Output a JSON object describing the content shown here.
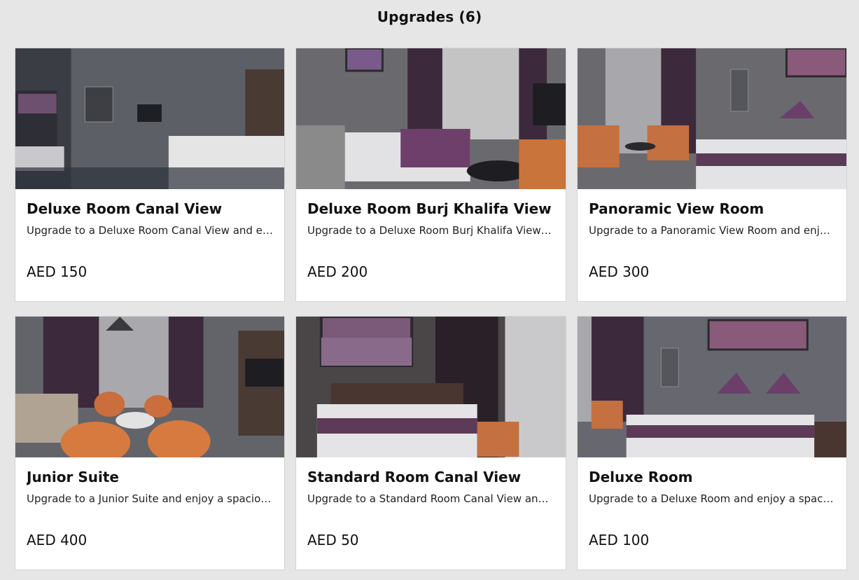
{
  "header": {
    "title": "Upgrades (6)"
  },
  "upgrades": [
    {
      "name": "Deluxe Room Canal View",
      "description": "Upgrade to a Deluxe Room Canal View and enjoy a spacious room",
      "price": "AED 150",
      "image": "hotel-room-photo"
    },
    {
      "name": "Deluxe Room Burj Khalifa View",
      "description": "Upgrade to a Deluxe Room Burj Khalifa View and enjoy a spacious room",
      "price": "AED 200",
      "image": "hotel-room-photo"
    },
    {
      "name": "Panoramic View Room",
      "description": "Upgrade to a Panoramic View Room and enjoy a spacious room",
      "price": "AED 300",
      "image": "hotel-room-photo"
    },
    {
      "name": "Junior Suite",
      "description": "Upgrade to a Junior Suite and enjoy a spacious room",
      "price": "AED 400",
      "image": "hotel-room-photo"
    },
    {
      "name": "Standard Room Canal View",
      "description": "Upgrade to a Standard Room Canal View and enjoy a spacious room",
      "price": "AED 50",
      "image": "hotel-room-photo"
    },
    {
      "name": "Deluxe Room",
      "description": "Upgrade to a Deluxe Room and enjoy a spacious room",
      "price": "AED 100",
      "image": "hotel-room-photo"
    }
  ],
  "colors": {
    "background": "#e6e6e6",
    "card": "#ffffff",
    "accent_purple": "#5a3a52"
  }
}
